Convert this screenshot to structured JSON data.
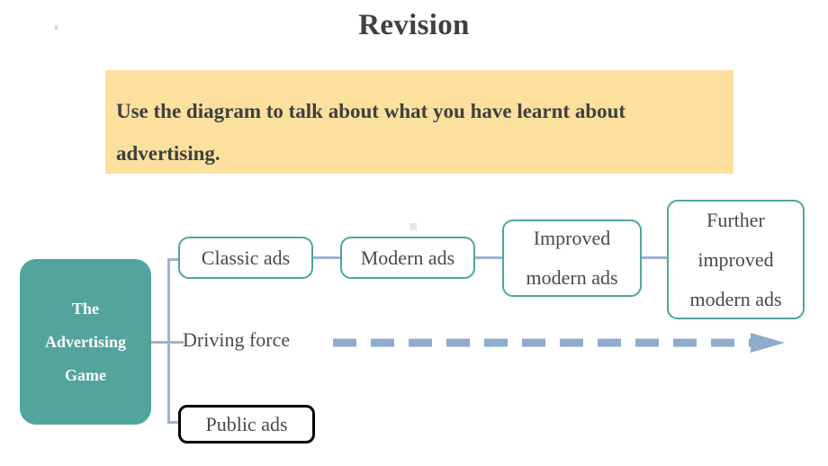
{
  "page": {
    "title": "Revision"
  },
  "instruction": {
    "text": "Use the diagram to talk about what you have learnt about advertising."
  },
  "diagram": {
    "root": {
      "label": "The\nAdvertising\nGame",
      "fill_color": "#52a49c",
      "text_color": "#ffffff"
    },
    "branches": [
      {
        "id": "ads-evolution-chain",
        "nodes": [
          {
            "label": "Classic ads",
            "border_color": "#4da69c"
          },
          {
            "label": "Modern ads",
            "border_color": "#4da69c"
          },
          {
            "label": "Improved\nmodern ads",
            "border_color": "#4da69c"
          },
          {
            "label": "Further\nimproved\nmodern ads",
            "border_color": "#4da69c"
          }
        ]
      },
      {
        "id": "driving-force",
        "label": "Driving force",
        "arrow": {
          "style": "dashed",
          "direction": "right",
          "color": "#8faccd"
        }
      },
      {
        "id": "public-ads",
        "label": "Public ads",
        "border_color": "#000000"
      }
    ],
    "connector_color": "#9db4d0"
  },
  "colors": {
    "banner_background": "#fbe09e",
    "title_text": "#404040",
    "body_text": "#4a4a4a",
    "accent_teal": "#52a49c",
    "connector_blue": "#9db4d0",
    "arrow_blue": "#8faccd"
  }
}
